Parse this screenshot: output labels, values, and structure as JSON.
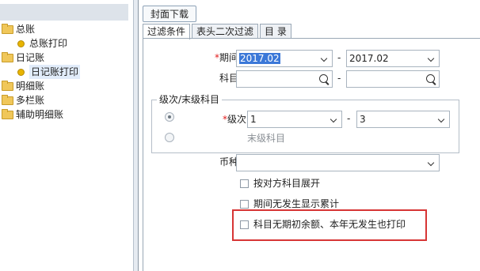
{
  "tree": {
    "items": [
      {
        "label": "总账",
        "icon": "folder-icon"
      },
      {
        "label": "总账打印",
        "icon": "leaf-icon"
      },
      {
        "label": "日记账",
        "icon": "folder-icon"
      },
      {
        "label": "日记账打印",
        "icon": "leaf-icon"
      },
      {
        "label": "明细账",
        "icon": "folder-icon"
      },
      {
        "label": "多栏账",
        "icon": "folder-icon"
      },
      {
        "label": "辅助明细账",
        "icon": "folder-icon"
      }
    ]
  },
  "toolbar": {
    "cover_download": "封面下载"
  },
  "tabs": [
    {
      "label": "过滤条件",
      "active": true
    },
    {
      "label": "表头二次过滤",
      "active": false
    },
    {
      "label": "目 录",
      "active": false
    }
  ],
  "form": {
    "period_label": "期间",
    "period_from": "2017.02",
    "period_to": "2017.02",
    "range_dash": "-",
    "subject_label": "科目",
    "subject_from": "",
    "subject_to": "",
    "grade_group_title": "级次/末级科目",
    "grade_label": "级次",
    "grade_from": "1",
    "grade_to": "3",
    "last_level_label": "末级科目",
    "currency_label": "币种",
    "currency_value": "",
    "options": [
      {
        "label": "按对方科目展开",
        "checked": false
      },
      {
        "label": "期间无发生显示累计",
        "checked": false
      },
      {
        "label": "科目无期初余额、本年无发生也打印",
        "checked": false
      }
    ]
  },
  "colors": {
    "highlight_border": "#d73535",
    "required_mark": "#e21b1b",
    "selection": "#3b78d8"
  }
}
